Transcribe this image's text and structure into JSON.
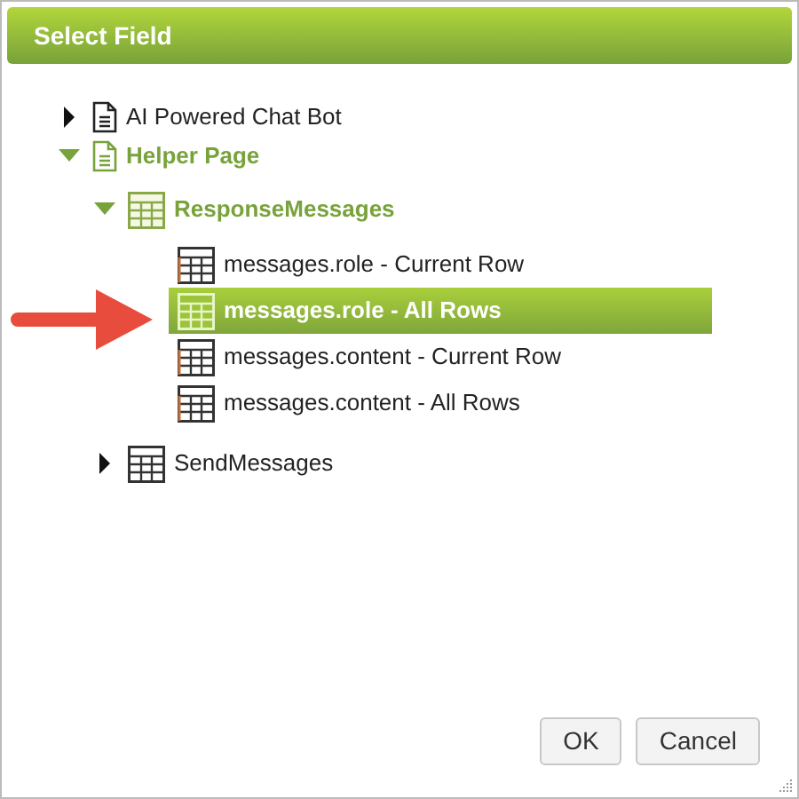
{
  "dialog": {
    "title": "Select Field"
  },
  "tree": [
    {
      "label": "AI Powered Chat Bot",
      "kind": "page",
      "expanded": false,
      "on_path": false,
      "selected": false
    },
    {
      "label": "Helper Page",
      "kind": "page",
      "expanded": true,
      "on_path": true,
      "selected": false,
      "children": [
        {
          "label": "ResponseMessages",
          "kind": "table",
          "expanded": true,
          "on_path": true,
          "selected": false,
          "children": [
            {
              "label": "messages.role - Current Row",
              "kind": "field",
              "on_path": false,
              "selected": false
            },
            {
              "label": "messages.role - All Rows",
              "kind": "field",
              "on_path": false,
              "selected": true
            },
            {
              "label": "messages.content - Current Row",
              "kind": "field",
              "on_path": false,
              "selected": false
            },
            {
              "label": "messages.content - All Rows",
              "kind": "field",
              "on_path": false,
              "selected": false
            }
          ]
        },
        {
          "label": "SendMessages",
          "kind": "table",
          "expanded": false,
          "on_path": false,
          "selected": false
        }
      ]
    }
  ],
  "buttons": [
    {
      "label": "OK"
    },
    {
      "label": "Cancel"
    }
  ]
}
